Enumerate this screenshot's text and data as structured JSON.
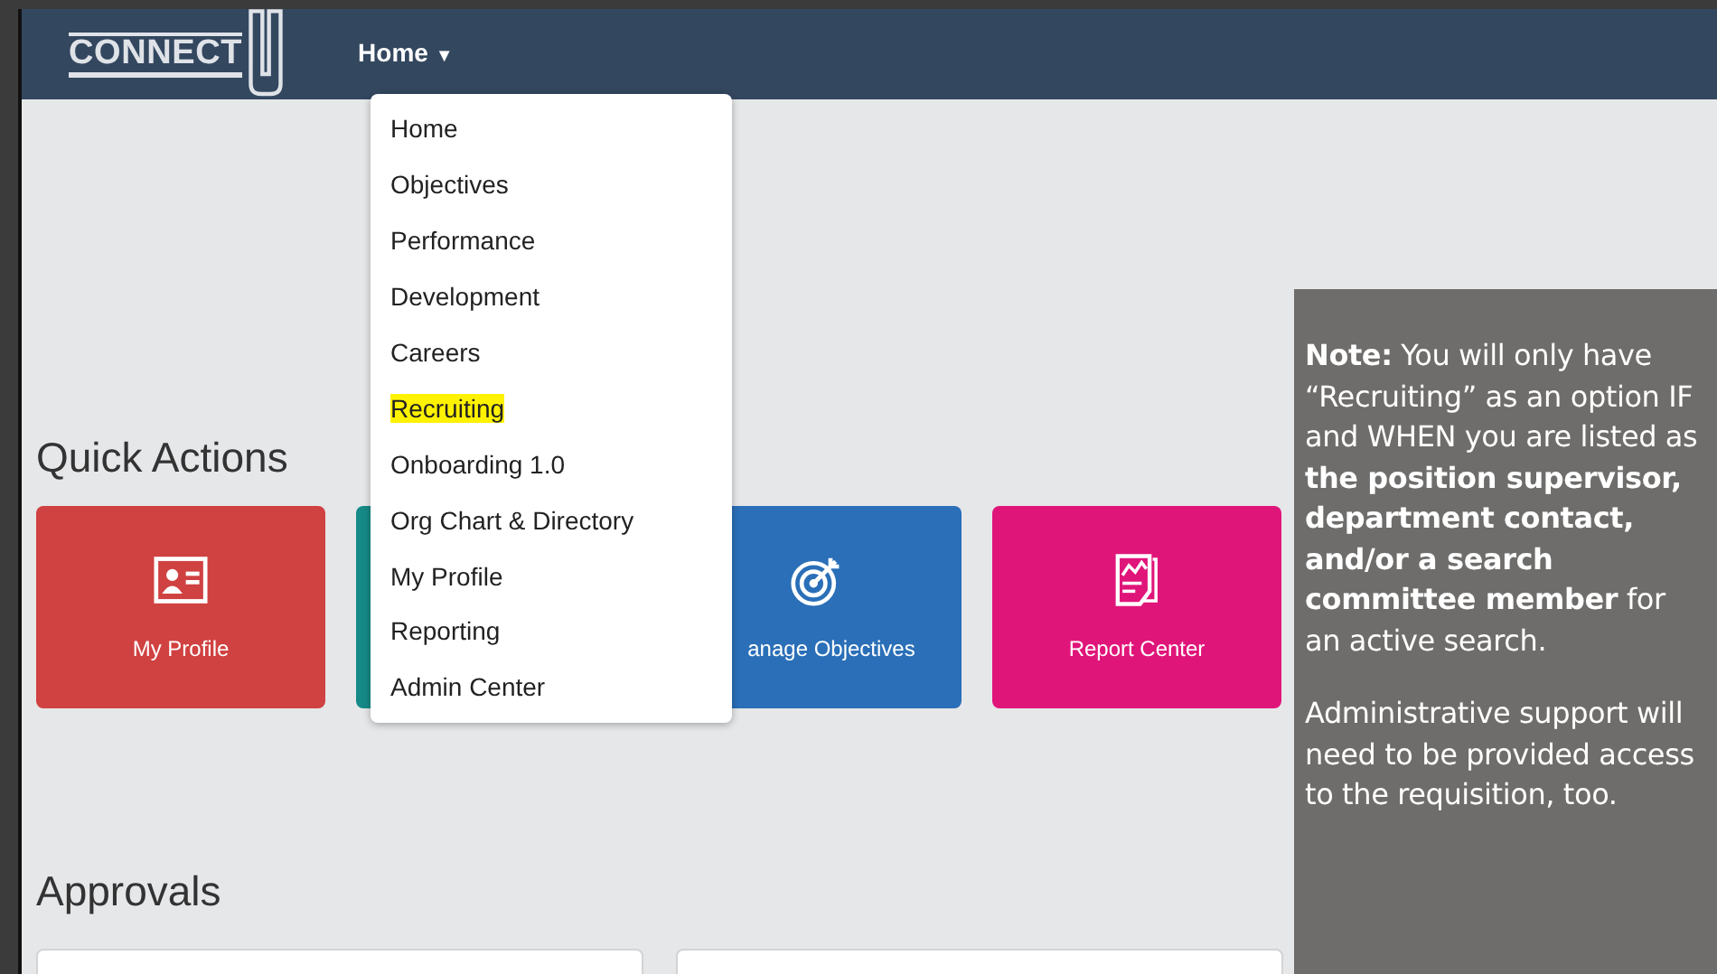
{
  "header": {
    "logo": "CONNECT",
    "nav_label": "Home",
    "nav_caret": "▼"
  },
  "menu": {
    "expanded": true,
    "items": [
      {
        "label": "Home",
        "highlighted": false
      },
      {
        "label": "Objectives",
        "highlighted": false
      },
      {
        "label": "Performance",
        "highlighted": false
      },
      {
        "label": "Development",
        "highlighted": false
      },
      {
        "label": "Careers",
        "highlighted": false
      },
      {
        "label": "Recruiting",
        "highlighted": true
      },
      {
        "label": "Onboarding 1.0",
        "highlighted": false
      },
      {
        "label": "Org Chart & Directory",
        "highlighted": false
      },
      {
        "label": "My Profile",
        "highlighted": false
      },
      {
        "label": "Reporting",
        "highlighted": false
      },
      {
        "label": "Admin Center",
        "highlighted": false
      }
    ]
  },
  "quick_actions": {
    "title": "Quick Actions",
    "tiles": [
      {
        "label": "My Profile",
        "kind": "profile",
        "color": "#d04141"
      },
      {
        "kind": "hidden",
        "color": "#168a87"
      },
      {
        "label": "anage Objectives",
        "kind": "target",
        "color": "#2a6fb8"
      },
      {
        "label": "Report Center",
        "kind": "report",
        "color": "#e0157a"
      }
    ]
  },
  "approvals": {
    "title": "Approvals"
  },
  "note": {
    "paragraphs": [
      "**Note:**  You will only have “Recruiting” as an option IF and WHEN you are listed as **the position supervisor, department contact, and/or a search committee member** for an active search.",
      "Administrative support will need to be provided access to the requisition, too."
    ]
  }
}
